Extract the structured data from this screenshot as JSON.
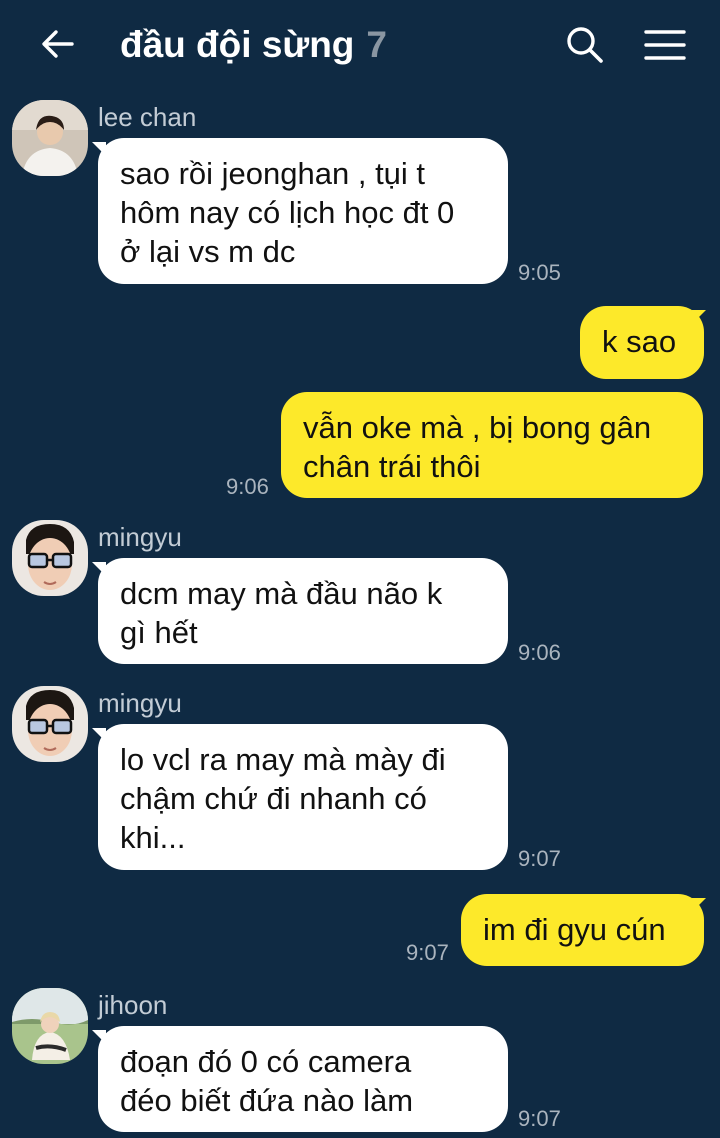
{
  "header": {
    "title": "đầu đội sừng",
    "member_count": "7",
    "back_icon": "arrow-left-icon",
    "search_icon": "search-icon",
    "menu_icon": "hamburger-menu-icon"
  },
  "colors": {
    "background": "#0f2a43",
    "incoming_bubble": "#ffffff",
    "outgoing_bubble": "#fde92a",
    "timestamp": "#aab4be",
    "member_count": "#8a96a2"
  },
  "messages": [
    {
      "sender": "lee chan",
      "text": "sao rồi jeonghan , tụi t\nhôm nay có lịch học đt 0\nở lại vs m dc",
      "time": "9:05",
      "direction": "incoming"
    },
    {
      "sender": "",
      "text": "k sao",
      "time": "",
      "direction": "outgoing"
    },
    {
      "sender": "",
      "text": "vẫn oke mà , bị bong gân\nchân trái thôi",
      "time": "9:06",
      "direction": "outgoing"
    },
    {
      "sender": "mingyu",
      "text": "dcm may mà đầu não k\ngì hết",
      "time": "9:06",
      "direction": "incoming"
    },
    {
      "sender": "mingyu",
      "text": "lo vcl ra may mà mày đi\nchậm chứ đi nhanh có\nkhi...",
      "time": "9:07",
      "direction": "incoming"
    },
    {
      "sender": "",
      "text": "im đi gyu cún",
      "time": "9:07",
      "direction": "outgoing"
    },
    {
      "sender": "jihoon",
      "text": "đoạn đó 0 có camera\nđéo biết đứa nào làm",
      "time": "9:07",
      "direction": "incoming"
    }
  ]
}
